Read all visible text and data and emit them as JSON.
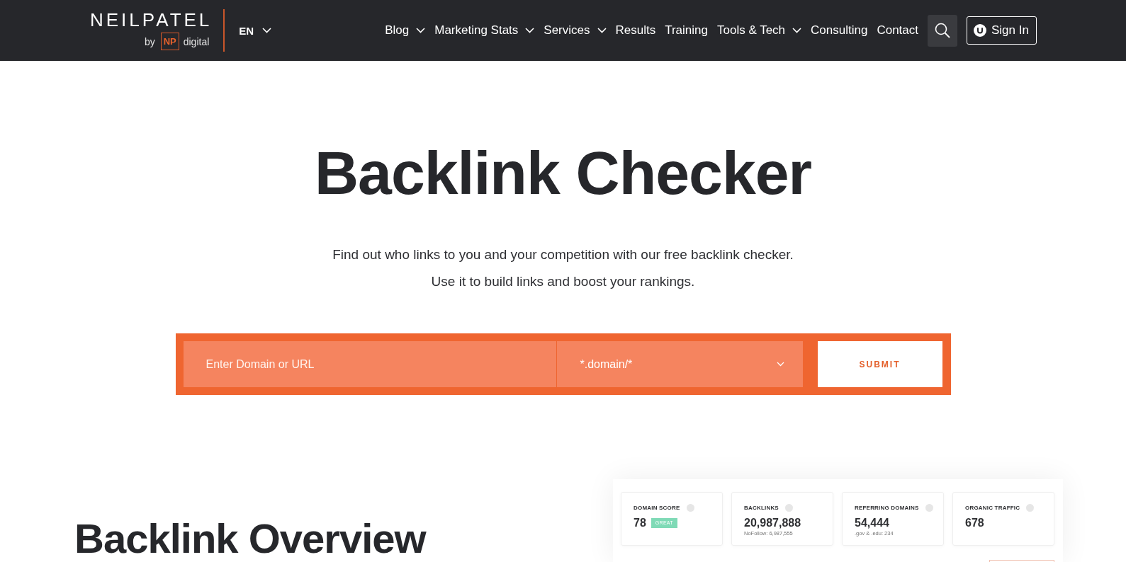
{
  "header": {
    "logo": {
      "wordmark": "NEILPATEL",
      "by": "by",
      "badge": "NP",
      "suffix": "digital"
    },
    "language": {
      "label": "EN"
    },
    "nav": [
      {
        "label": "Blog",
        "dropdown": true
      },
      {
        "label": "Marketing Stats",
        "dropdown": true
      },
      {
        "label": "Services",
        "dropdown": true
      },
      {
        "label": "Results",
        "dropdown": false
      },
      {
        "label": "Training",
        "dropdown": false
      },
      {
        "label": "Tools & Tech",
        "dropdown": true
      },
      {
        "label": "Consulting",
        "dropdown": false
      },
      {
        "label": "Contact",
        "dropdown": false
      }
    ],
    "sign_in": {
      "label": "Sign In"
    }
  },
  "hero": {
    "title": "Backlink Checker",
    "lines": [
      "Find out who links to you and your competition with our free backlink checker.",
      "Use it to build links and boost your rankings."
    ]
  },
  "search_form": {
    "domain_field": {
      "placeholder": "Enter Domain or URL"
    },
    "scope_select": {
      "value": "*.domain/*"
    },
    "submit": {
      "label": "SUBMIT"
    }
  },
  "overview": {
    "title": "Backlink Overview",
    "stats": [
      {
        "label": "DOMAIN SCORE",
        "value": "78",
        "badge": "GREAT"
      },
      {
        "label": "BACKLINKS",
        "value": "20,987,888",
        "note": "NoFollow: 6,987,555"
      },
      {
        "label": "REFERRING DOMAINS",
        "value": "54,444",
        "note": ".gov & .edu: 234"
      },
      {
        "label": "ORGANIC TRAFFIC",
        "value": "678"
      }
    ]
  }
}
